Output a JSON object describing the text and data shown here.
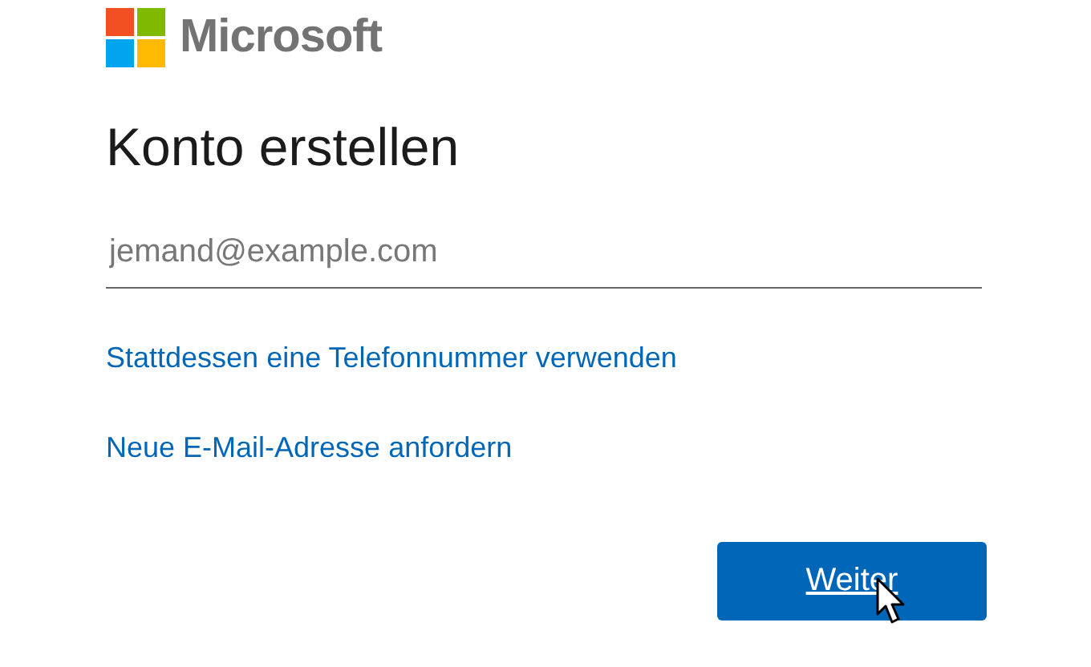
{
  "logo": {
    "text": "Microsoft"
  },
  "title": "Konto erstellen",
  "email_field": {
    "placeholder": "jemand@example.com"
  },
  "links": [
    "Stattdessen eine Telefonnummer verwenden",
    "Neue E-Mail-Adresse anfordern"
  ],
  "button": {
    "label": "Weiter"
  }
}
